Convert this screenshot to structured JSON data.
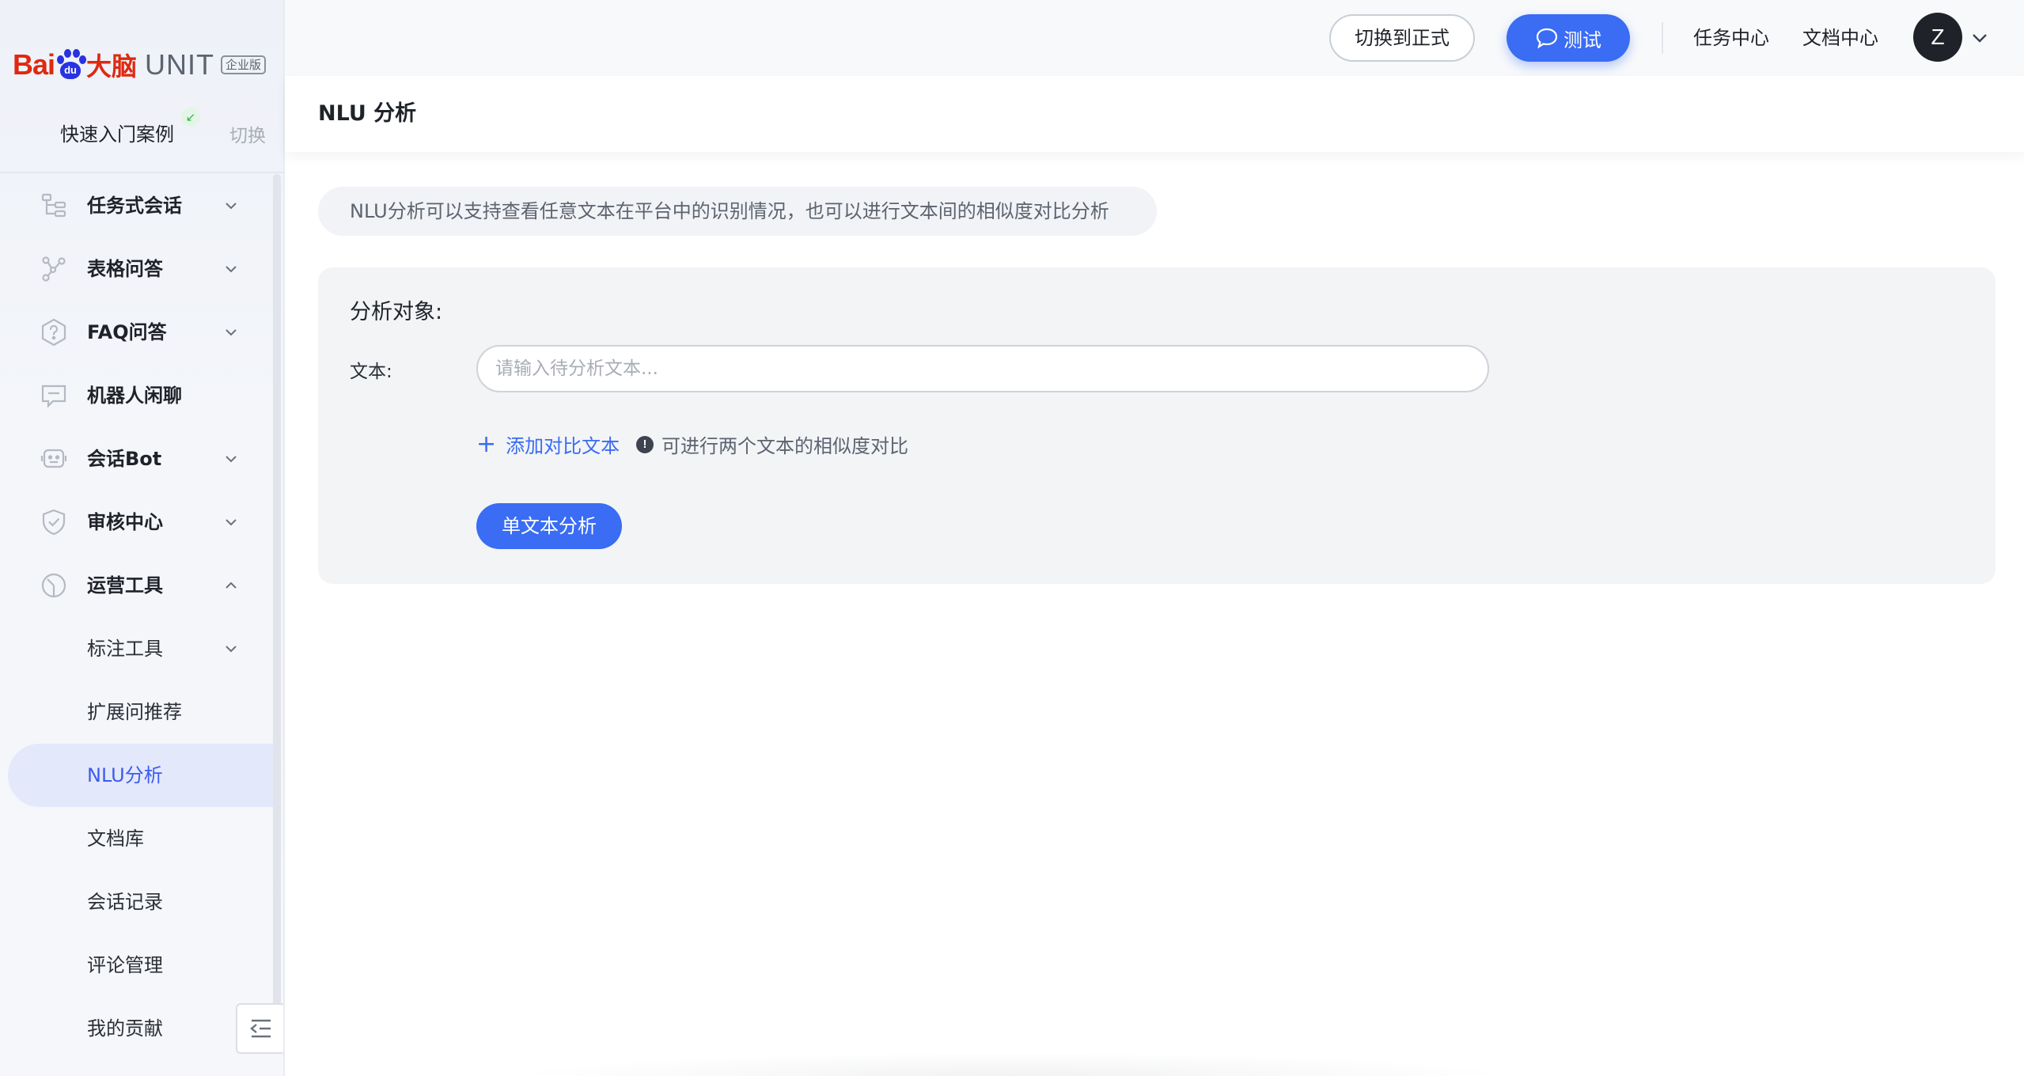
{
  "sidebar": {
    "logo": {
      "brand_baidu": "Bai",
      "brand_du": "du",
      "brand_danao": "大脑",
      "product": "UNIT",
      "edition": "企业版"
    },
    "quick_case": "快速入门案例",
    "switch_label": "切换",
    "items": [
      {
        "label": "任务式会话",
        "icon": "tree-structure-icon",
        "chevron": "down"
      },
      {
        "label": "表格问答",
        "icon": "graph-nodes-icon",
        "chevron": "down"
      },
      {
        "label": "FAQ问答",
        "icon": "question-hexagon-icon",
        "chevron": "down"
      },
      {
        "label": "机器人闲聊",
        "icon": "chat-box-icon",
        "chevron": ""
      },
      {
        "label": "会话Bot",
        "icon": "robot-icon",
        "chevron": "down"
      },
      {
        "label": "审核中心",
        "icon": "shield-check-icon",
        "chevron": "down"
      },
      {
        "label": "运营工具",
        "icon": "dashboard-icon",
        "chevron": "up"
      }
    ],
    "sub_items": [
      {
        "label": "标注工具",
        "chevron": "down"
      },
      {
        "label": "扩展问推荐"
      },
      {
        "label": "NLU分析",
        "active": true
      },
      {
        "label": "文档库"
      },
      {
        "label": "会话记录"
      },
      {
        "label": "评论管理"
      },
      {
        "label": "我的贡献"
      }
    ]
  },
  "topbar": {
    "switch_formal": "切换到正式",
    "test": "测试",
    "task_center": "任务中心",
    "doc_center": "文档中心",
    "avatar_letter": "Z"
  },
  "page": {
    "title": "NLU 分析",
    "notice": "NLU分析可以支持查看任意文本在平台中的识别情况，也可以进行文本间的相似度对比分析"
  },
  "panel": {
    "title": "分析对象:",
    "text_label": "文本:",
    "text_placeholder": "请输入待分析文本...",
    "text_value": "",
    "add_compare": "添加对比文本",
    "hint": "可进行两个文本的相似度对比",
    "analyze_button": "单文本分析"
  },
  "colors": {
    "accent": "#3a6cf4",
    "active_bg": "#e4e8fb",
    "brand_red": "#de2910",
    "brand_blue": "#2932e1"
  }
}
